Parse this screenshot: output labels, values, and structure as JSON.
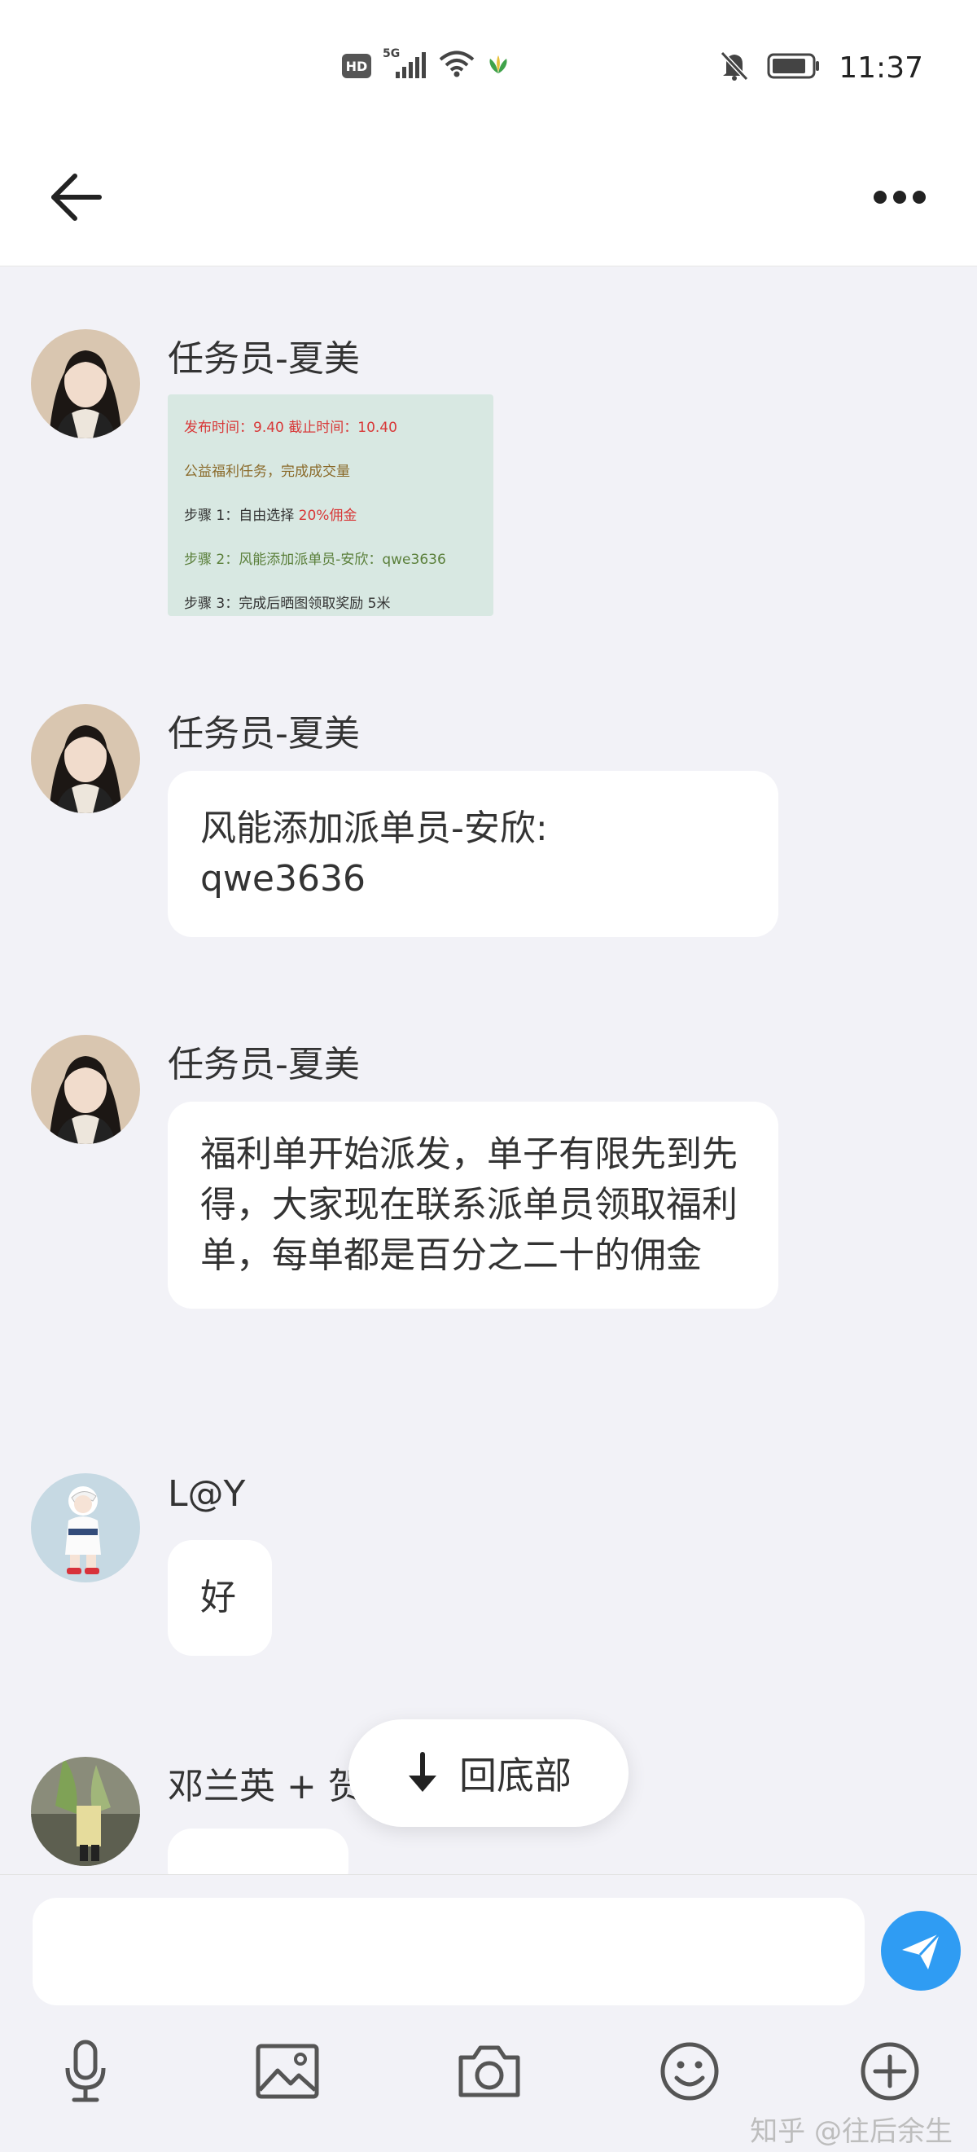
{
  "status_bar": {
    "network_badge": "HD",
    "network_type": "5G",
    "time": "11:37",
    "icons": [
      "hd-icon",
      "signal-icon",
      "wifi-icon",
      "app-notification-icon",
      "mute-icon",
      "battery-icon"
    ]
  },
  "top_bar": {
    "back_icon": "arrow-left-icon",
    "more_icon": "more-dots-icon"
  },
  "messages": [
    {
      "sender": "任务员-夏美",
      "type": "image",
      "image_lines": {
        "line1_label": "发布时间：",
        "line1_value": "9.40",
        "line1_label2": "截止时间：",
        "line1_value2": "10.40",
        "line2": "公益福利任务，完成成交量",
        "line3_label": "步骤 1：自由选择 ",
        "line3_value": "20%佣金",
        "line4": "步骤 2：风能添加派单员-安欣：qwe3636",
        "line5": "步骤 3：完成后晒图领取奖励 5米"
      }
    },
    {
      "sender": "任务员-夏美",
      "type": "text",
      "text": "风能添加派单员-安欣:\nqwe3636"
    },
    {
      "sender": "任务员-夏美",
      "type": "text",
      "text": "福利单开始派发，单子有限先到先得，大家现在联系派单员领取福利单，每单都是百分之二十的佣金"
    },
    {
      "sender": "L@Y",
      "type": "text",
      "text": "好"
    },
    {
      "sender": "邓兰英 + 贺",
      "type": "text",
      "text": ""
    }
  ],
  "scroll_to_bottom": {
    "label": "回底部",
    "icon": "arrow-down-icon"
  },
  "input_bar": {
    "placeholder": "",
    "send_icon": "send-icon",
    "tools": [
      "microphone-icon",
      "image-icon",
      "camera-icon",
      "emoji-icon",
      "plus-circle-icon"
    ]
  },
  "watermark": "知乎 @往后余生",
  "colors": {
    "accent": "#2f9cf3",
    "background": "#f2f2f7",
    "bubble": "#ffffff"
  }
}
